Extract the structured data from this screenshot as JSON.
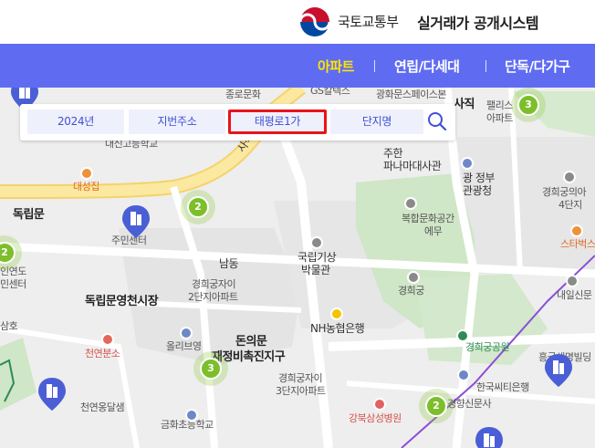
{
  "header": {
    "ministry": "국토교통부",
    "system": "실거래가 공개시스템"
  },
  "nav": {
    "items": [
      {
        "label": "아파트",
        "active": true
      },
      {
        "label": "연립/다세대",
        "active": false
      },
      {
        "label": "단독/다가구",
        "active": false
      }
    ]
  },
  "search": {
    "year": "2024년",
    "address_type": "지번주소",
    "dong": "태평로1가",
    "complex": "단지명",
    "highlight_color": "#e8141a"
  },
  "map": {
    "labels": {
      "jongno_culture": "종로문화",
      "gs_caltex": "GS칼텍스",
      "gwanghwamun_4": "광화문스페이스본",
      "sajik": "사직",
      "palace_apt": "팰리스",
      "palace_apt2": "아파트",
      "daesin_school": "대신고등학교",
      "sajik_ro": "사직터널",
      "daesungjip": "대성집",
      "dongnimmun": "독립문",
      "community_center": "주민센터",
      "south_dong": "남동",
      "gyeonghui_1": "경희궁자이",
      "gyeonghui_1b": "2단지아파트",
      "dongnimmun_market": "독립문영천시장",
      "gyeonghui_3": "경희궁자이",
      "gyeonghui_3b": "3단지아파트",
      "donuimun": "돈의문",
      "donuimun_2": "재정비촉진지구",
      "olivista": "올리브영",
      "cheonyeon_bunso": "천연분소",
      "cheonyeon_ong": "천연옹달샘",
      "geumhwa_school": "금화초등학교",
      "national_weather": "국립기상",
      "national_weather_2": "박물관",
      "nh_bank": "NH농협은행",
      "gyeonghuigung": "경희궁",
      "gyeonghuigung_park": "경희궁공원",
      "kangbuk_hospital": "강북삼성병원",
      "korea_citi": "한국씨티은행",
      "gyeonghyang": "경향신문사",
      "complex_culture": "복합문화공간",
      "complex_culture_2": "에무",
      "gov_office": "광 정부",
      "gov_office_2": "관광청",
      "pana_embassy": "주한",
      "pana_embassy_2": "파나마대사관",
      "gyeonghui_4": "경희궁의아",
      "gyeonghui_4b": "4단지",
      "starbucks": "스타벅스",
      "naeil_school": "내일신문",
      "heungkuk": "흥국생명빌딩",
      "min_center_left": "인연도",
      "min_center_left_2": "민센터",
      "sam_ho": "삼호",
      "gs_oil": "독립문"
    },
    "clusters": [
      "3",
      "2",
      "2",
      "3",
      "2"
    ]
  },
  "colors": {
    "nav_bg": "#5f6cf2",
    "nav_active": "#ffe600",
    "cluster": "#7cbf2a",
    "building_marker": "#4a5fd6"
  }
}
